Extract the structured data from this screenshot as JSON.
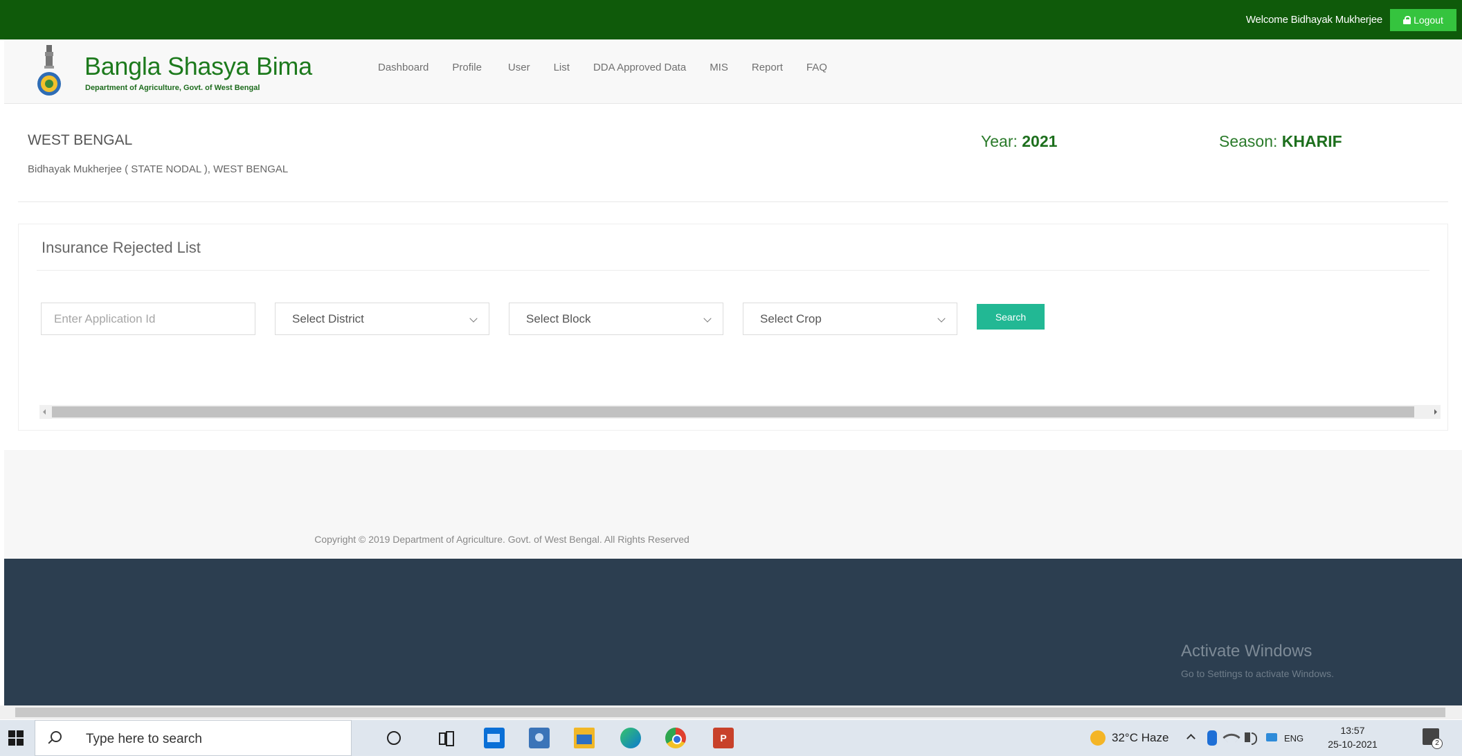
{
  "topbar": {
    "welcome": "Welcome Bidhayak Mukherjee",
    "logout_label": "Logout"
  },
  "header": {
    "brand_title": "Bangla Shasya Bima",
    "brand_subtitle": "Department of Agriculture, Govt. of West Bengal",
    "nav": [
      "Dashboard",
      "Profile",
      "User",
      "List",
      "DDA Approved Data",
      "MIS",
      "Report",
      "FAQ"
    ]
  },
  "info": {
    "state": "WEST BENGAL",
    "user_line": "Bidhayak Mukherjee ( STATE NODAL ), WEST BENGAL",
    "year_label": "Year:",
    "year_value": "2021",
    "season_label": "Season:",
    "season_value": "KHARIF"
  },
  "card": {
    "title": "Insurance Rejected List",
    "application_placeholder": "Enter Application Id",
    "district_select": "Select District",
    "block_select": "Select Block",
    "crop_select": "Select Crop",
    "search_label": "Search"
  },
  "footer": {
    "copyright": "Copyright © 2019 Department of Agriculture. Govt. of West Bengal. All Rights Reserved",
    "activate_title": "Activate Windows",
    "activate_sub": "Go to Settings to activate Windows."
  },
  "taskbar": {
    "search_placeholder": "Type here to search",
    "ppt_label": "P",
    "weather": "32°C  Haze",
    "lang": "ENG",
    "time": "13:57",
    "date": "25-10-2021",
    "notifications": "2"
  },
  "colors": {
    "topbar": "#0f5a0a",
    "logout": "#35c43e",
    "brand": "#1d7a1d",
    "search_button": "#22b894",
    "footer_dark": "#2c3e50"
  }
}
